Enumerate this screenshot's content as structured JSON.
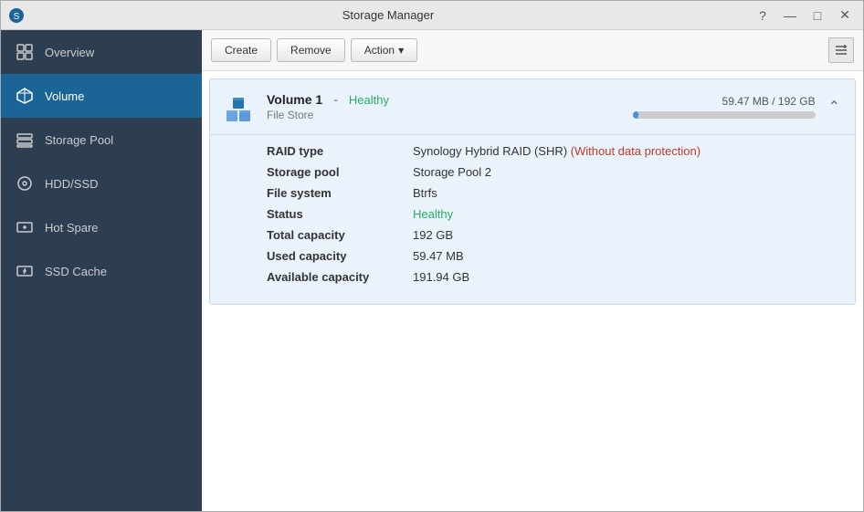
{
  "window": {
    "title": "Storage Manager",
    "help_icon": "?",
    "minimize_icon": "—",
    "maximize_icon": "□",
    "close_icon": "✕"
  },
  "sidebar": {
    "items": [
      {
        "id": "overview",
        "label": "Overview",
        "icon": "grid-icon"
      },
      {
        "id": "volume",
        "label": "Volume",
        "icon": "cube-icon",
        "active": true
      },
      {
        "id": "storage-pool",
        "label": "Storage Pool",
        "icon": "storage-icon"
      },
      {
        "id": "hdd-ssd",
        "label": "HDD/SSD",
        "icon": "disk-icon"
      },
      {
        "id": "hot-spare",
        "label": "Hot Spare",
        "icon": "plus-disk-icon"
      },
      {
        "id": "ssd-cache",
        "label": "SSD Cache",
        "icon": "lightning-disk-icon"
      }
    ]
  },
  "toolbar": {
    "create_label": "Create",
    "remove_label": "Remove",
    "action_label": "Action",
    "action_arrow": "▾",
    "view_icon": "list-view-icon"
  },
  "volume": {
    "name": "Volume 1",
    "dash": "-",
    "status": "Healthy",
    "subtitle": "File Store",
    "capacity_text": "59.47 MB / 192 GB",
    "capacity_percent": 0.031,
    "details": {
      "raid_type_label": "RAID type",
      "raid_type_value": "Synology Hybrid RAID (SHR)",
      "raid_warning": "(Without data protection)",
      "storage_pool_label": "Storage pool",
      "storage_pool_value": "Storage Pool 2",
      "file_system_label": "File system",
      "file_system_value": "Btrfs",
      "status_label": "Status",
      "status_value": "Healthy",
      "total_capacity_label": "Total capacity",
      "total_capacity_value": "192 GB",
      "used_capacity_label": "Used capacity",
      "used_capacity_value": "59.47 MB",
      "available_capacity_label": "Available capacity",
      "available_capacity_value": "191.94 GB"
    }
  }
}
